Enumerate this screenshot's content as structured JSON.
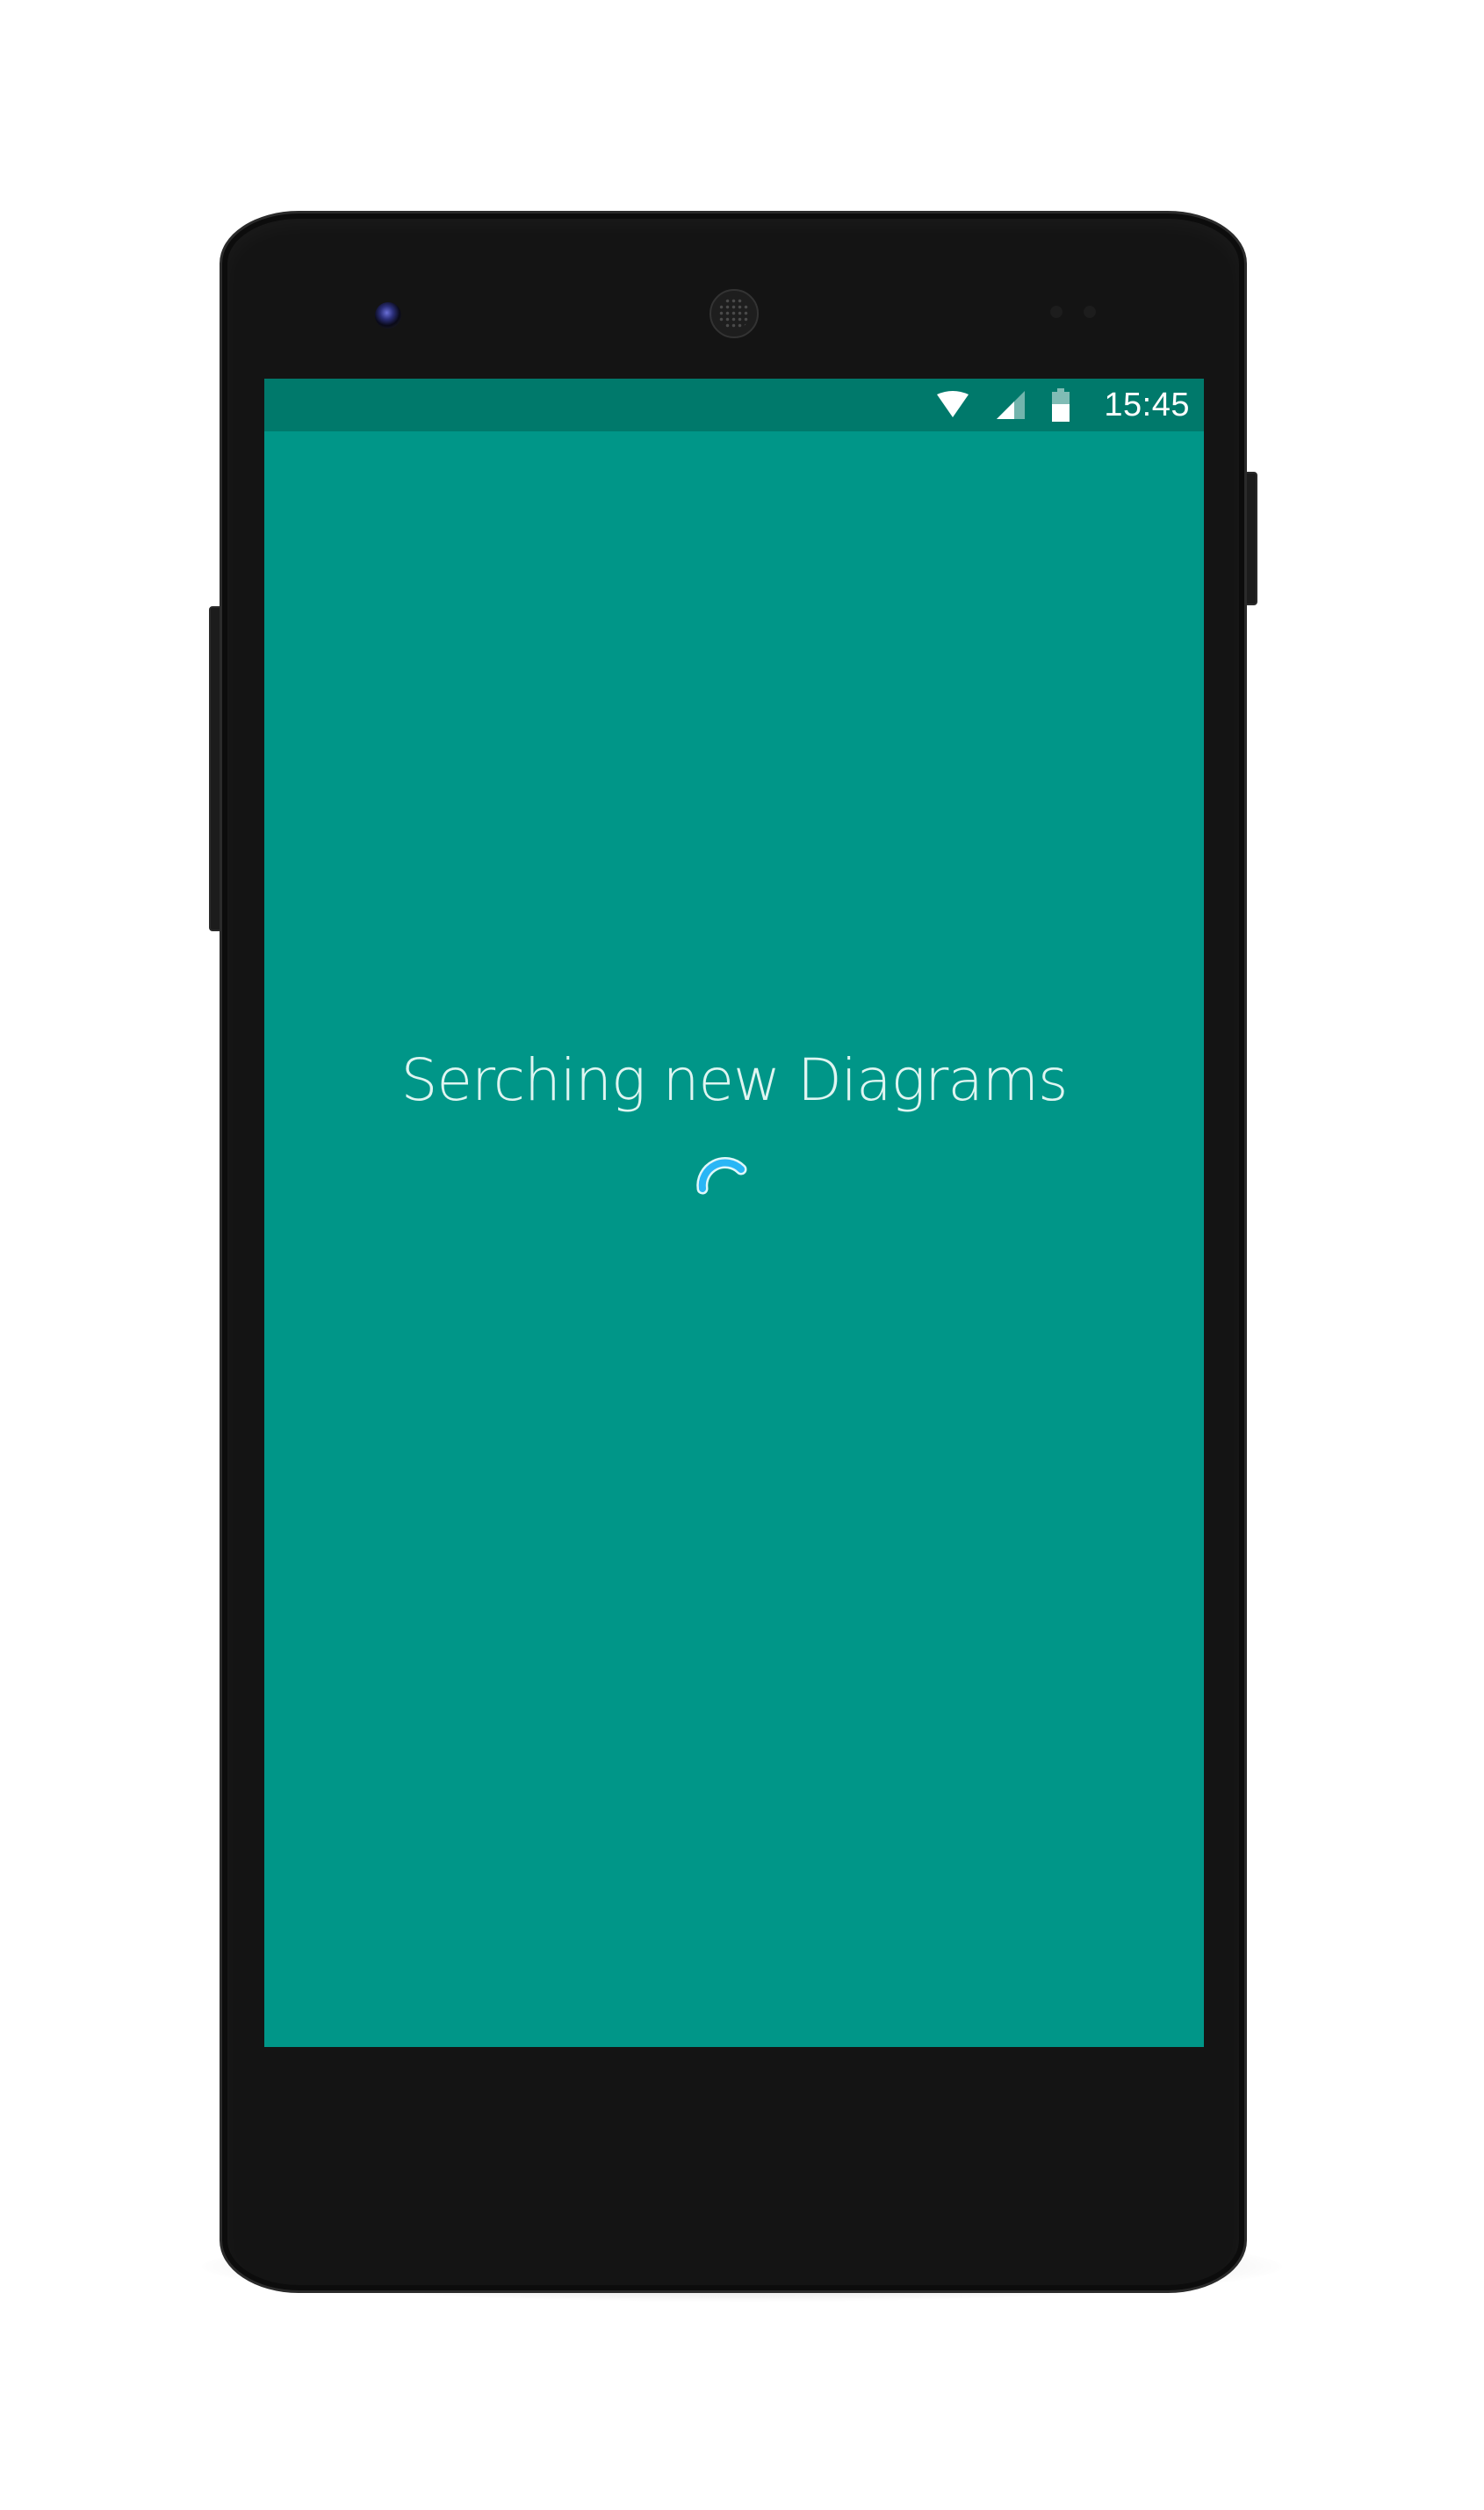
{
  "device": {
    "name": "android-phone"
  },
  "status_bar": {
    "time": "15:45",
    "icons": [
      "wifi-icon",
      "cell-signal-icon",
      "battery-icon"
    ]
  },
  "screen": {
    "background_color": "#009688",
    "status_bar_color": "#00796b",
    "message": "Serching new Diagrams",
    "spinner_color": "#29b6f6"
  }
}
